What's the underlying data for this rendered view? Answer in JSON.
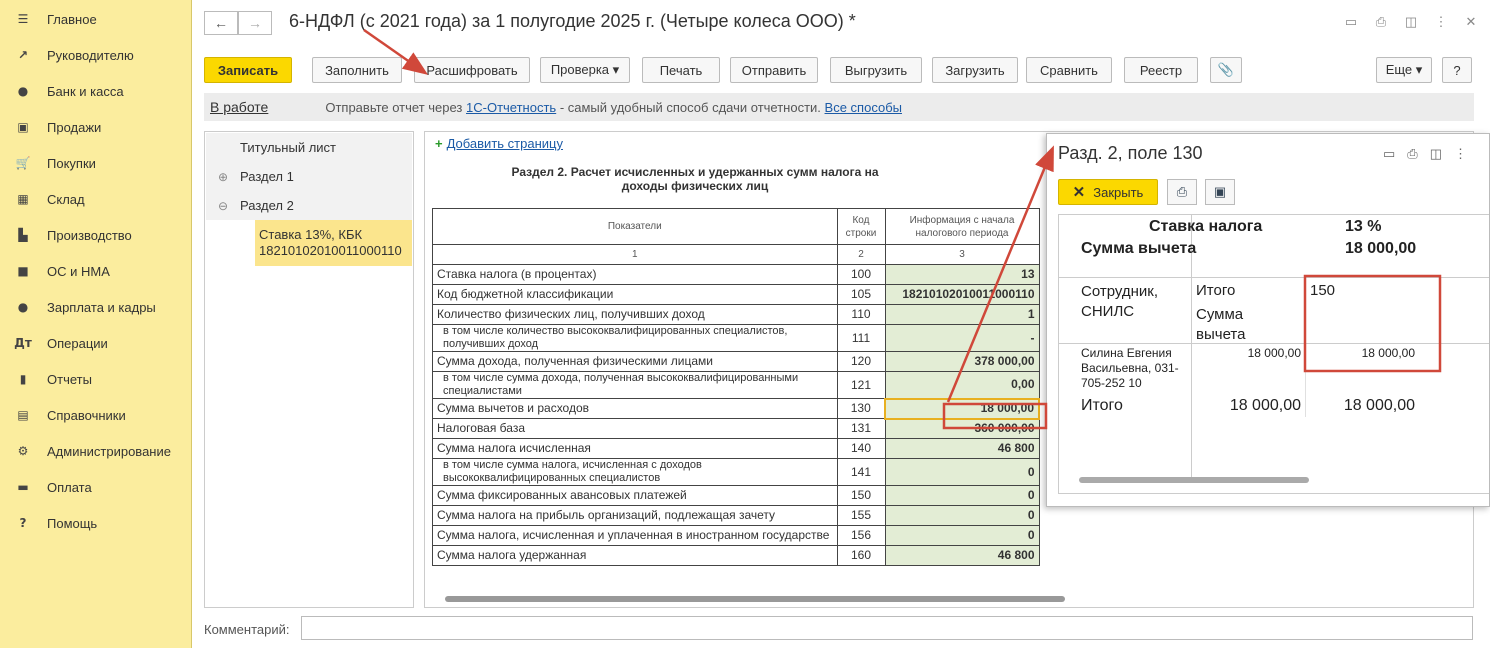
{
  "sidebar": {
    "items": [
      {
        "label": "Главное",
        "icon": "menu-icon",
        "glyph": "☰"
      },
      {
        "label": "Руководителю",
        "icon": "trend-icon",
        "glyph": "↗"
      },
      {
        "label": "Банк и касса",
        "icon": "coin-icon",
        "glyph": "●"
      },
      {
        "label": "Продажи",
        "icon": "bag-icon",
        "glyph": "▣"
      },
      {
        "label": "Покупки",
        "icon": "cart-icon",
        "glyph": "🛒"
      },
      {
        "label": "Склад",
        "icon": "warehouse-icon",
        "glyph": "▦"
      },
      {
        "label": "Производство",
        "icon": "factory-icon",
        "glyph": "▙"
      },
      {
        "label": "ОС и НМА",
        "icon": "truck-icon",
        "glyph": "■"
      },
      {
        "label": "Зарплата и кадры",
        "icon": "person-icon",
        "glyph": "●"
      },
      {
        "label": "Операции",
        "icon": "dt-kt-icon",
        "glyph": "Дт"
      },
      {
        "label": "Отчеты",
        "icon": "bar-chart-icon",
        "glyph": "▮"
      },
      {
        "label": "Справочники",
        "icon": "books-icon",
        "glyph": "▤"
      },
      {
        "label": "Администрирование",
        "icon": "gear-icon",
        "glyph": "⚙"
      },
      {
        "label": "Оплата",
        "icon": "wallet-icon",
        "glyph": "▬"
      },
      {
        "label": "Помощь",
        "icon": "help-icon",
        "glyph": "?"
      }
    ]
  },
  "header": {
    "back_glyph": "←",
    "forward_glyph": "→",
    "title": "6-НДФЛ (с 2021 года) за 1 полугодие 2025 г. (Четыре колеса ООО) *",
    "icons": [
      "save-icon",
      "print-icon",
      "preview-icon",
      "more-icon",
      "close-icon"
    ],
    "icon_glyphs": [
      "▭",
      "⎙",
      "◫",
      "⋮",
      "✕"
    ]
  },
  "toolbar": {
    "buttons": [
      {
        "label": "Записать",
        "name": "write-button"
      },
      {
        "label": "Заполнить",
        "name": "fill-button"
      },
      {
        "label": "Расшифровать",
        "name": "decipher-button"
      },
      {
        "label": "Проверка ▾",
        "name": "check-button"
      },
      {
        "label": "Печать",
        "name": "print-button"
      },
      {
        "label": "Отправить",
        "name": "send-button"
      },
      {
        "label": "Выгрузить",
        "name": "export-button"
      },
      {
        "label": "Загрузить",
        "name": "import-button"
      },
      {
        "label": "Сравнить",
        "name": "compare-button"
      },
      {
        "label": "Реестр",
        "name": "registry-button"
      },
      {
        "label": "📎",
        "name": "attach-button"
      },
      {
        "label": "Еще ▾",
        "name": "more-button"
      },
      {
        "label": "?",
        "name": "help-button"
      }
    ]
  },
  "status": {
    "state": "В работе",
    "text_before": "Отправьте отчет через ",
    "link1": "1С-Отчетность",
    "text_middle": " - самый удобный способ сдачи отчетности. ",
    "link2": "Все способы"
  },
  "tree": {
    "title_sheet": "Титульный лист",
    "section1": "Раздел 1",
    "section2": "Раздел 2",
    "expand_glyph": "⊕",
    "collapse_glyph": "⊖",
    "selected_line1": "Ставка 13%, КБК",
    "selected_line2": "18210102010011000110"
  },
  "report": {
    "add_page": "Добавить страницу",
    "plus": "+",
    "section_title": "Раздел 2. Расчет исчисленных и удержанных сумм налога на доходы физических лиц",
    "head": {
      "col1": "Показатели",
      "col2": "Код строки",
      "col3": "Информация с начала налогового периода",
      "n1": "1",
      "n2": "2",
      "n3": "3"
    },
    "rows": [
      {
        "label": "Ставка налога (в процентах)",
        "code": "100",
        "value": "13",
        "indent": false
      },
      {
        "label": "Код бюджетной классификации",
        "code": "105",
        "value": "18210102010011000110",
        "indent": false
      },
      {
        "label": "Количество физических лиц, получивших доход",
        "code": "110",
        "value": "1",
        "indent": false
      },
      {
        "label": "в том числе количество высококвалифицированных специалистов, получивших доход",
        "code": "111",
        "value": "-",
        "indent": true
      },
      {
        "label": "Сумма дохода, полученная физическими лицами",
        "code": "120",
        "value": "378 000,00",
        "indent": false
      },
      {
        "label": "в том числе сумма дохода, полученная высококвалифицированными специалистами",
        "code": "121",
        "value": "0,00",
        "indent": true
      },
      {
        "label": "Сумма вычетов и расходов",
        "code": "130",
        "value": "18 000,00",
        "indent": false,
        "highlight": true
      },
      {
        "label": "Налоговая база",
        "code": "131",
        "value": "360 000,00",
        "indent": false
      },
      {
        "label": "Сумма налога исчисленная",
        "code": "140",
        "value": "46 800",
        "indent": false
      },
      {
        "label": "в том числе сумма налога, исчисленная с доходов высококвалифицированных специалистов",
        "code": "141",
        "value": "0",
        "indent": true
      },
      {
        "label": "Сумма фиксированных авансовых платежей",
        "code": "150",
        "value": "0",
        "indent": false
      },
      {
        "label": "Сумма налога на прибыль организаций, подлежащая зачету",
        "code": "155",
        "value": "0",
        "indent": false
      },
      {
        "label": "Сумма налога, исчисленная и уплаченная в иностранном государстве",
        "code": "156",
        "value": "0",
        "indent": false
      },
      {
        "label": "Сумма налога удержанная",
        "code": "160",
        "value": "46 800",
        "indent": false
      }
    ]
  },
  "popup": {
    "title": "Разд. 2, поле 130",
    "close_label": "Закрыть",
    "close_glyph": "✕",
    "icon_glyphs": [
      "▭",
      "⎙",
      "◫",
      "⋮"
    ],
    "print_glyph": "⎙",
    "save_glyph": "▣",
    "rate_label": "Ставка налога",
    "rate_value": "13 %",
    "deduction_label": "Сумма вычета",
    "deduction_value": "18 000,00",
    "col_employee": "Сотрудник, СНИЛС",
    "col_total": "Итого",
    "col_deduction": "Сумма вычета",
    "col_code": "150",
    "employee_name": "Силина Евгения Васильевна, 031-705-252 10",
    "employee_total": "18 000,00",
    "employee_deduction": "18 000,00",
    "footer_label": "Итого",
    "footer_total": "18 000,00",
    "footer_deduction": "18 000,00"
  },
  "comment": {
    "label": "Комментарий:",
    "value": ""
  },
  "colors": {
    "sidebar_bg": "#fbed9e",
    "primary_button": "#fbd800",
    "link": "#1b5aa6",
    "value_cell": "#e3edd5",
    "annotation": "#d0483a"
  }
}
